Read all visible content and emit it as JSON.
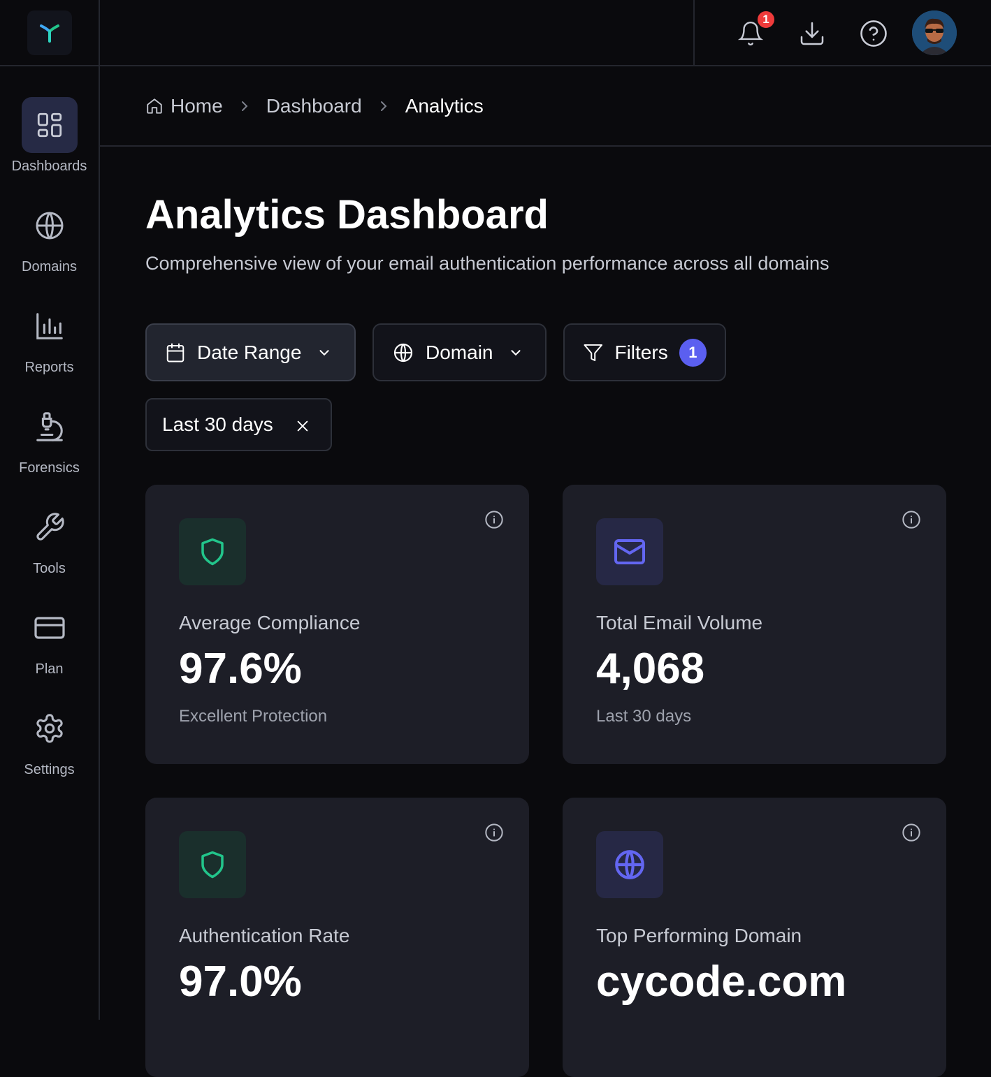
{
  "sidebar": {
    "items": [
      {
        "label": "Dashboards",
        "icon": "dashboard-grid-icon",
        "active": true
      },
      {
        "label": "Domains",
        "icon": "globe-icon"
      },
      {
        "label": "Reports",
        "icon": "bar-chart-icon"
      },
      {
        "label": "Forensics",
        "icon": "microscope-icon"
      },
      {
        "label": "Tools",
        "icon": "wrench-icon"
      },
      {
        "label": "Plan",
        "icon": "credit-card-icon"
      },
      {
        "label": "Settings",
        "icon": "gear-icon"
      }
    ]
  },
  "topbar": {
    "notification_count": "1"
  },
  "breadcrumb": {
    "items": [
      "Home",
      "Dashboard",
      "Analytics"
    ]
  },
  "page": {
    "title": "Analytics Dashboard",
    "subtitle": "Comprehensive view of your email authentication performance across all domains"
  },
  "filters": {
    "date_range_label": "Date Range",
    "domain_label": "Domain",
    "filters_label": "Filters",
    "filters_count": "1",
    "active_chip": "Last 30 days"
  },
  "cards": [
    {
      "label": "Average Compliance",
      "value": "97.6%",
      "sub": "Excellent Protection",
      "icon": "shield-icon",
      "accent": "#22c58b"
    },
    {
      "label": "Total Email Volume",
      "value": "4,068",
      "sub": "Last 30 days",
      "icon": "mail-icon",
      "accent": "#6366f1"
    },
    {
      "label": "Authentication Rate",
      "value": "97.0%",
      "sub": "",
      "icon": "shield-icon",
      "accent": "#22c58b"
    },
    {
      "label": "Top Performing Domain",
      "value": "cycode.com",
      "sub": "",
      "icon": "globe-icon",
      "accent": "#6366f1"
    }
  ],
  "colors": {
    "background": "#0a0a0d",
    "card": "#1d1e27",
    "accent_indigo": "#5b5ff0",
    "accent_green": "#22c58b",
    "badge_red": "#ef3b3b"
  }
}
